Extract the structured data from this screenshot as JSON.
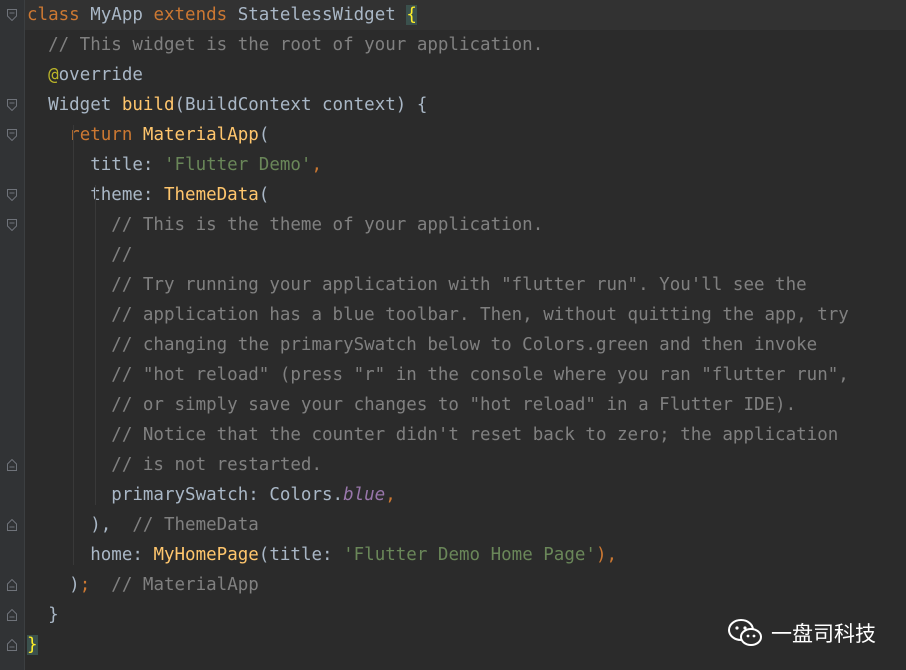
{
  "editor": {
    "lines": [
      [
        {
          "t": "class ",
          "c": "kw"
        },
        {
          "t": "MyApp ",
          "c": "cls"
        },
        {
          "t": "extends ",
          "c": "kw"
        },
        {
          "t": "StatelessWidget ",
          "c": "cls"
        },
        {
          "t": "{",
          "c": "brace-hl"
        }
      ],
      [
        {
          "t": "  // This widget is the root of your application.",
          "c": "cmt"
        }
      ],
      [
        {
          "t": "  ",
          "c": ""
        },
        {
          "t": "@",
          "c": "ann"
        },
        {
          "t": "override",
          "c": "cls"
        }
      ],
      [
        {
          "t": "  Widget ",
          "c": "cls"
        },
        {
          "t": "build",
          "c": "fn"
        },
        {
          "t": "(BuildContext context) {",
          "c": "cls"
        }
      ],
      [
        {
          "t": "    ",
          "c": ""
        },
        {
          "t": "return ",
          "c": "kw"
        },
        {
          "t": "MaterialApp",
          "c": "fn"
        },
        {
          "t": "(",
          "c": "cls"
        }
      ],
      [
        {
          "t": "      title: ",
          "c": "cls"
        },
        {
          "t": "'Flutter Demo'",
          "c": "str"
        },
        {
          "t": ",",
          "c": "kw"
        }
      ],
      [
        {
          "t": "      theme: ",
          "c": "cls"
        },
        {
          "t": "ThemeData",
          "c": "fn"
        },
        {
          "t": "(",
          "c": "cls"
        }
      ],
      [
        {
          "t": "        // This is the theme of your application.",
          "c": "cmt"
        }
      ],
      [
        {
          "t": "        //",
          "c": "cmt"
        }
      ],
      [
        {
          "t": "        // Try running your application with \"flutter run\". You'll see the",
          "c": "cmt"
        }
      ],
      [
        {
          "t": "        // application has a blue toolbar. Then, without quitting the app, try",
          "c": "cmt"
        }
      ],
      [
        {
          "t": "        // changing the primarySwatch below to Colors.green and then invoke",
          "c": "cmt"
        }
      ],
      [
        {
          "t": "        // \"hot reload\" (press \"r\" in the console where you ran \"flutter run\",",
          "c": "cmt"
        }
      ],
      [
        {
          "t": "        // or simply save your changes to \"hot reload\" in a Flutter IDE).",
          "c": "cmt"
        }
      ],
      [
        {
          "t": "        // Notice that the counter didn't reset back to zero; the application",
          "c": "cmt"
        }
      ],
      [
        {
          "t": "        // is not restarted.",
          "c": "cmt"
        }
      ],
      [
        {
          "t": "        primarySwatch: Colors.",
          "c": "cls"
        },
        {
          "t": "blue",
          "c": "ital"
        },
        {
          "t": ",",
          "c": "kw"
        }
      ],
      [
        {
          "t": "      ),  ",
          "c": "cls"
        },
        {
          "t": "// ThemeData",
          "c": "cmt"
        }
      ],
      [
        {
          "t": "      home: ",
          "c": "cls"
        },
        {
          "t": "MyHomePage",
          "c": "fn"
        },
        {
          "t": "(title: ",
          "c": "cls"
        },
        {
          "t": "'Flutter Demo Home Page'",
          "c": "str"
        },
        {
          "t": "),",
          "c": "kw"
        }
      ],
      [
        {
          "t": "    )",
          "c": "cls"
        },
        {
          "t": ";  ",
          "c": "kw"
        },
        {
          "t": "// MaterialApp",
          "c": "cmt"
        }
      ],
      [
        {
          "t": "  }",
          "c": "cls"
        }
      ],
      [
        {
          "t": "}",
          "c": "brace-hl"
        }
      ]
    ],
    "fold_markers": [
      {
        "line": 0,
        "kind": "open"
      },
      {
        "line": 3,
        "kind": "open"
      },
      {
        "line": 4,
        "kind": "open"
      },
      {
        "line": 6,
        "kind": "open"
      },
      {
        "line": 7,
        "kind": "open"
      },
      {
        "line": 15,
        "kind": "close"
      },
      {
        "line": 17,
        "kind": "close"
      },
      {
        "line": 19,
        "kind": "close"
      },
      {
        "line": 20,
        "kind": "close"
      },
      {
        "line": 21,
        "kind": "close"
      }
    ]
  },
  "colors": {
    "background": "#2b2b2b",
    "keyword": "#cc7832",
    "function": "#ffc66d",
    "comment": "#808080",
    "string": "#6a8759",
    "annotation": "#bbb529",
    "constant": "#9876aa"
  },
  "watermark": {
    "icon": "wechat-icon",
    "text": "一盘司科技"
  }
}
